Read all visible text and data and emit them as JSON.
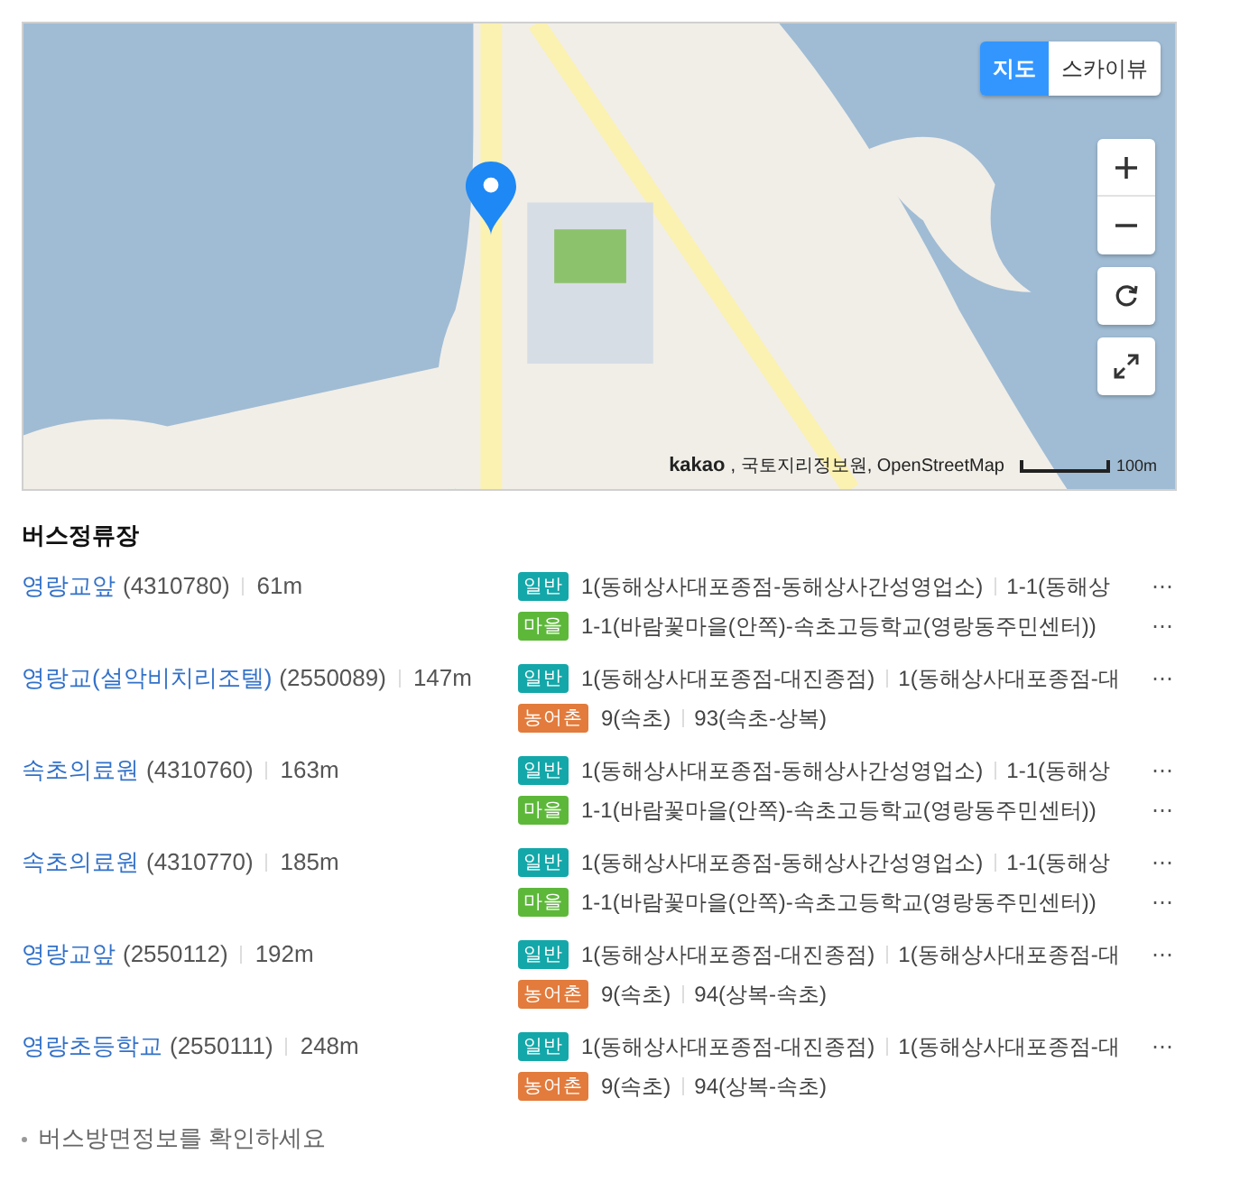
{
  "map": {
    "view_toggle": [
      {
        "label": "지도",
        "selected": true
      },
      {
        "label": "스카이뷰",
        "selected": false
      }
    ],
    "attribution_logo": "kakao",
    "attribution": ", 국토지리정보원, OpenStreetMap",
    "scale": "100m"
  },
  "section_title": "버스정류장",
  "stops": [
    {
      "name": "영랑교앞",
      "code": "(4310780)",
      "distance": "61m",
      "routes": [
        {
          "kind": "general",
          "badge": "일반",
          "items": [
            "1(동해상사대포종점-동해상사간성영업소)",
            "1-1(동해상"
          ],
          "more": "⋯"
        },
        {
          "kind": "village",
          "badge": "마을",
          "items": [
            "1-1(바람꽃마을(안쪽)-속초고등학교(영랑동주민센터))"
          ],
          "more": "⋯"
        }
      ]
    },
    {
      "name": "영랑교(설악비치리조텔)",
      "code": "(2550089)",
      "distance": "147m",
      "routes": [
        {
          "kind": "general",
          "badge": "일반",
          "items": [
            "1(동해상사대포종점-대진종점)",
            "1(동해상사대포종점-대"
          ],
          "more": "⋯"
        },
        {
          "kind": "rural",
          "badge": "농어촌",
          "items": [
            "9(속초)",
            "93(속초-상복)"
          ]
        }
      ]
    },
    {
      "name": "속초의료원",
      "code": "(4310760)",
      "distance": "163m",
      "routes": [
        {
          "kind": "general",
          "badge": "일반",
          "items": [
            "1(동해상사대포종점-동해상사간성영업소)",
            "1-1(동해상"
          ],
          "more": "⋯"
        },
        {
          "kind": "village",
          "badge": "마을",
          "items": [
            "1-1(바람꽃마을(안쪽)-속초고등학교(영랑동주민센터))"
          ],
          "more": "⋯"
        }
      ]
    },
    {
      "name": "속초의료원",
      "code": "(4310770)",
      "distance": "185m",
      "routes": [
        {
          "kind": "general",
          "badge": "일반",
          "items": [
            "1(동해상사대포종점-동해상사간성영업소)",
            "1-1(동해상"
          ],
          "more": "⋯"
        },
        {
          "kind": "village",
          "badge": "마을",
          "items": [
            "1-1(바람꽃마을(안쪽)-속초고등학교(영랑동주민센터))"
          ],
          "more": "⋯"
        }
      ]
    },
    {
      "name": "영랑교앞",
      "code": "(2550112)",
      "distance": "192m",
      "routes": [
        {
          "kind": "general",
          "badge": "일반",
          "items": [
            "1(동해상사대포종점-대진종점)",
            "1(동해상사대포종점-대"
          ],
          "more": "⋯"
        },
        {
          "kind": "rural",
          "badge": "농어촌",
          "items": [
            "9(속초)",
            "94(상복-속초)"
          ]
        }
      ]
    },
    {
      "name": "영랑초등학교",
      "code": "(2550111)",
      "distance": "248m",
      "routes": [
        {
          "kind": "general",
          "badge": "일반",
          "items": [
            "1(동해상사대포종점-대진종점)",
            "1(동해상사대포종점-대"
          ],
          "more": "⋯"
        },
        {
          "kind": "rural",
          "badge": "농어촌",
          "items": [
            "9(속초)",
            "94(상복-속초)"
          ]
        }
      ]
    }
  ],
  "note": "버스방면정보를 확인하세요"
}
